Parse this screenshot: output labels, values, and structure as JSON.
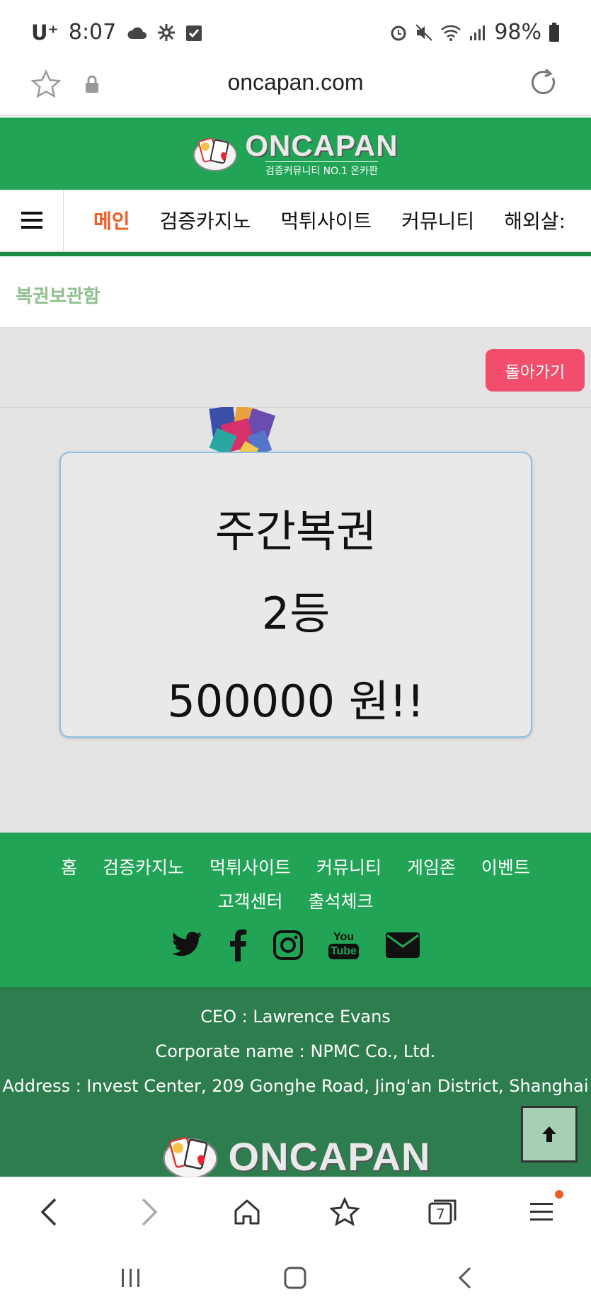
{
  "status_bar": {
    "carrier": "U⁺",
    "time": "8:07",
    "battery": "98%"
  },
  "url_bar": {
    "url": "oncapan.com"
  },
  "site": {
    "logo_main": "ONCAPAN",
    "logo_sub": "검증커뮤니티 NO.1 온카판"
  },
  "nav": {
    "items": [
      "메인",
      "검증카지노",
      "먹튀사이트",
      "커뮤니티",
      "해외살:"
    ]
  },
  "breadcrumb": "복권보관함",
  "back_button": "돌아가기",
  "lottery_card": {
    "title": "주간복권",
    "rank": "2등",
    "prize": "500000 원!!"
  },
  "footer": {
    "links_row1": [
      "홈",
      "검증카지노",
      "먹튀사이트",
      "커뮤니티",
      "게임존",
      "이벤트"
    ],
    "links_row2": [
      "고객센터",
      "출석체크"
    ],
    "social_icons": [
      "twitter-icon",
      "facebook-icon",
      "instagram-icon",
      "youtube-icon",
      "email-icon"
    ],
    "youtube_top": "You",
    "youtube_bottom": "Tube",
    "ceo": "CEO : Lawrence Evans",
    "corporate": "Corporate name : NPMC Co., Ltd.",
    "address": "Address : Invest Center, 209 Gonghe Road, Jing'an District, Shanghai",
    "logo_main": "ONCAPAN"
  },
  "browser_bar": {
    "tab_count": "7"
  },
  "colors": {
    "brand_green": "#21a456",
    "dark_green": "#2e7d4f",
    "accent_orange": "#f15a22",
    "back_button": "#f24d6b"
  }
}
